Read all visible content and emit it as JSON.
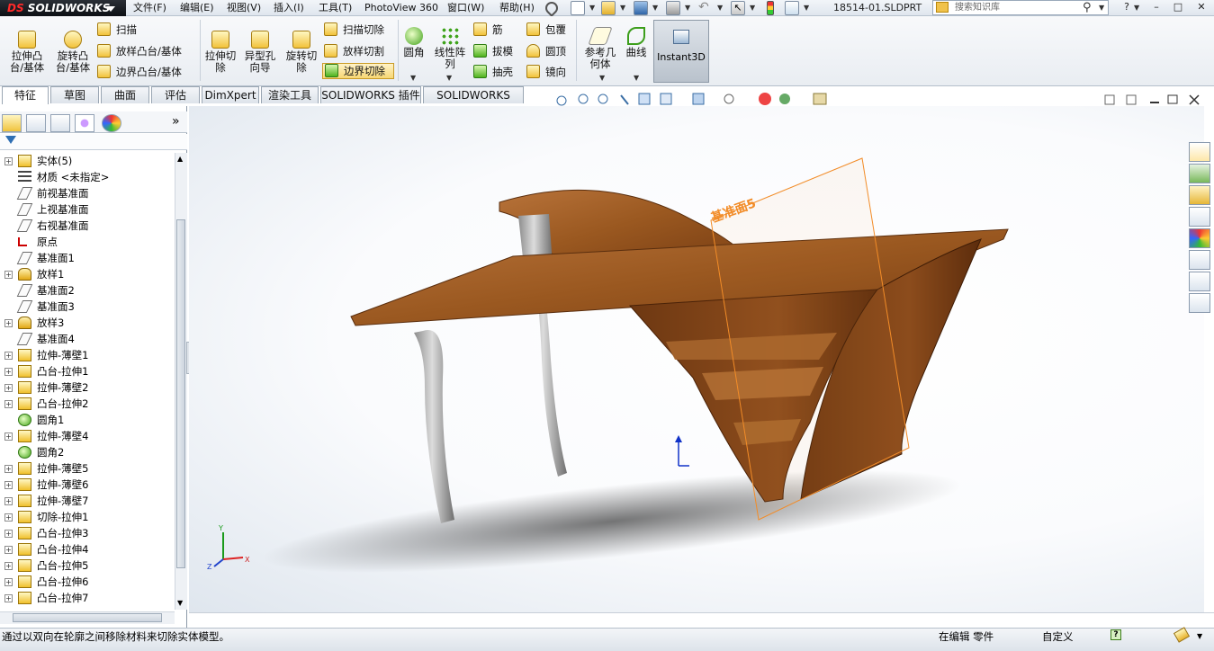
{
  "app": {
    "brand_prefix": "DS",
    "brand": "SOLIDWORKS",
    "document": "18514-01.SLDPRT"
  },
  "menu": [
    "文件(F)",
    "编辑(E)",
    "视图(V)",
    "插入(I)",
    "工具(T)",
    "PhotoView 360",
    "窗口(W)",
    "帮助(H)"
  ],
  "search": {
    "placeholder": "搜索知识库"
  },
  "window_controls": {
    "help": "?",
    "minimize": "–",
    "restore": "□",
    "close": "✕"
  },
  "ribbon": {
    "extrude_boss": "拉伸凸\n台/基体",
    "revolve_boss": "旋转凸\n台/基体",
    "sweep": "扫描",
    "loft_boss": "放样凸台/基体",
    "boundary_boss": "边界凸台/基体",
    "extrude_cut": "拉伸切\n除",
    "hole_wizard": "异型孔\n向导",
    "revolve_cut": "旋转切\n除",
    "swept_cut": "扫描切除",
    "lofted_cut": "放样切割",
    "boundary_cut": "边界切除",
    "fillet": "圆角",
    "linear_pattern": "线性阵\n列",
    "rib": "筋",
    "draft": "拔模",
    "shell": "抽壳",
    "wrap": "包覆",
    "dome": "圆顶",
    "mirror": "镜向",
    "ref_geometry": "参考几\n何体",
    "curves": "曲线",
    "instant3d": "Instant3D"
  },
  "tabs": [
    "特征",
    "草图",
    "曲面",
    "评估",
    "DimXpert",
    "渲染工具",
    "SOLIDWORKS 插件",
    "SOLIDWORKS MBD"
  ],
  "feature_tree": [
    {
      "label": "实体(5)",
      "icon": "solid-bodies-icon",
      "expand": "+"
    },
    {
      "label": "材质 <未指定>",
      "icon": "material-icon",
      "expand": ""
    },
    {
      "label": "前视基准面",
      "icon": "plane-icon",
      "expand": ""
    },
    {
      "label": "上视基准面",
      "icon": "plane-icon",
      "expand": ""
    },
    {
      "label": "右视基准面",
      "icon": "plane-icon",
      "expand": ""
    },
    {
      "label": "原点",
      "icon": "origin-icon",
      "expand": ""
    },
    {
      "label": "基准面1",
      "icon": "plane-icon",
      "expand": ""
    },
    {
      "label": "放样1",
      "icon": "loft-icon",
      "expand": "+"
    },
    {
      "label": "基准面2",
      "icon": "plane-icon",
      "expand": ""
    },
    {
      "label": "基准面3",
      "icon": "plane-icon",
      "expand": ""
    },
    {
      "label": "放样3",
      "icon": "loft-icon",
      "expand": "+"
    },
    {
      "label": "基准面4",
      "icon": "plane-icon",
      "expand": ""
    },
    {
      "label": "拉伸-薄壁1",
      "icon": "extrude-icon",
      "expand": "+"
    },
    {
      "label": "凸台-拉伸1",
      "icon": "extrude-icon",
      "expand": "+"
    },
    {
      "label": "拉伸-薄壁2",
      "icon": "extrude-icon",
      "expand": "+"
    },
    {
      "label": "凸台-拉伸2",
      "icon": "extrude-icon",
      "expand": "+"
    },
    {
      "label": "圆角1",
      "icon": "fillet-icon",
      "expand": ""
    },
    {
      "label": "拉伸-薄壁4",
      "icon": "extrude-icon",
      "expand": "+"
    },
    {
      "label": "圆角2",
      "icon": "fillet-icon",
      "expand": ""
    },
    {
      "label": "拉伸-薄壁5",
      "icon": "extrude-icon",
      "expand": "+"
    },
    {
      "label": "拉伸-薄壁6",
      "icon": "extrude-icon",
      "expand": "+"
    },
    {
      "label": "拉伸-薄壁7",
      "icon": "extrude-icon",
      "expand": "+"
    },
    {
      "label": "切除-拉伸1",
      "icon": "extrude-icon",
      "expand": "+"
    },
    {
      "label": "凸台-拉伸3",
      "icon": "extrude-icon",
      "expand": "+"
    },
    {
      "label": "凸台-拉伸4",
      "icon": "extrude-icon",
      "expand": "+"
    },
    {
      "label": "凸台-拉伸5",
      "icon": "extrude-icon",
      "expand": "+"
    },
    {
      "label": "凸台-拉伸6",
      "icon": "extrude-icon",
      "expand": "+"
    },
    {
      "label": "凸台-拉伸7",
      "icon": "extrude-icon",
      "expand": "+"
    }
  ],
  "viewport": {
    "plane_label": "基准面5",
    "triad_x": "X",
    "triad_y": "Y",
    "triad_z": "Z"
  },
  "status": {
    "message": "通过以双向在轮廓之间移除材料来切除实体模型。",
    "mode": "在编辑 零件",
    "units": "自定义"
  },
  "colors": {
    "accent": "#f28c28",
    "wood": "#9c5a23",
    "plane": "#f49a3c"
  }
}
